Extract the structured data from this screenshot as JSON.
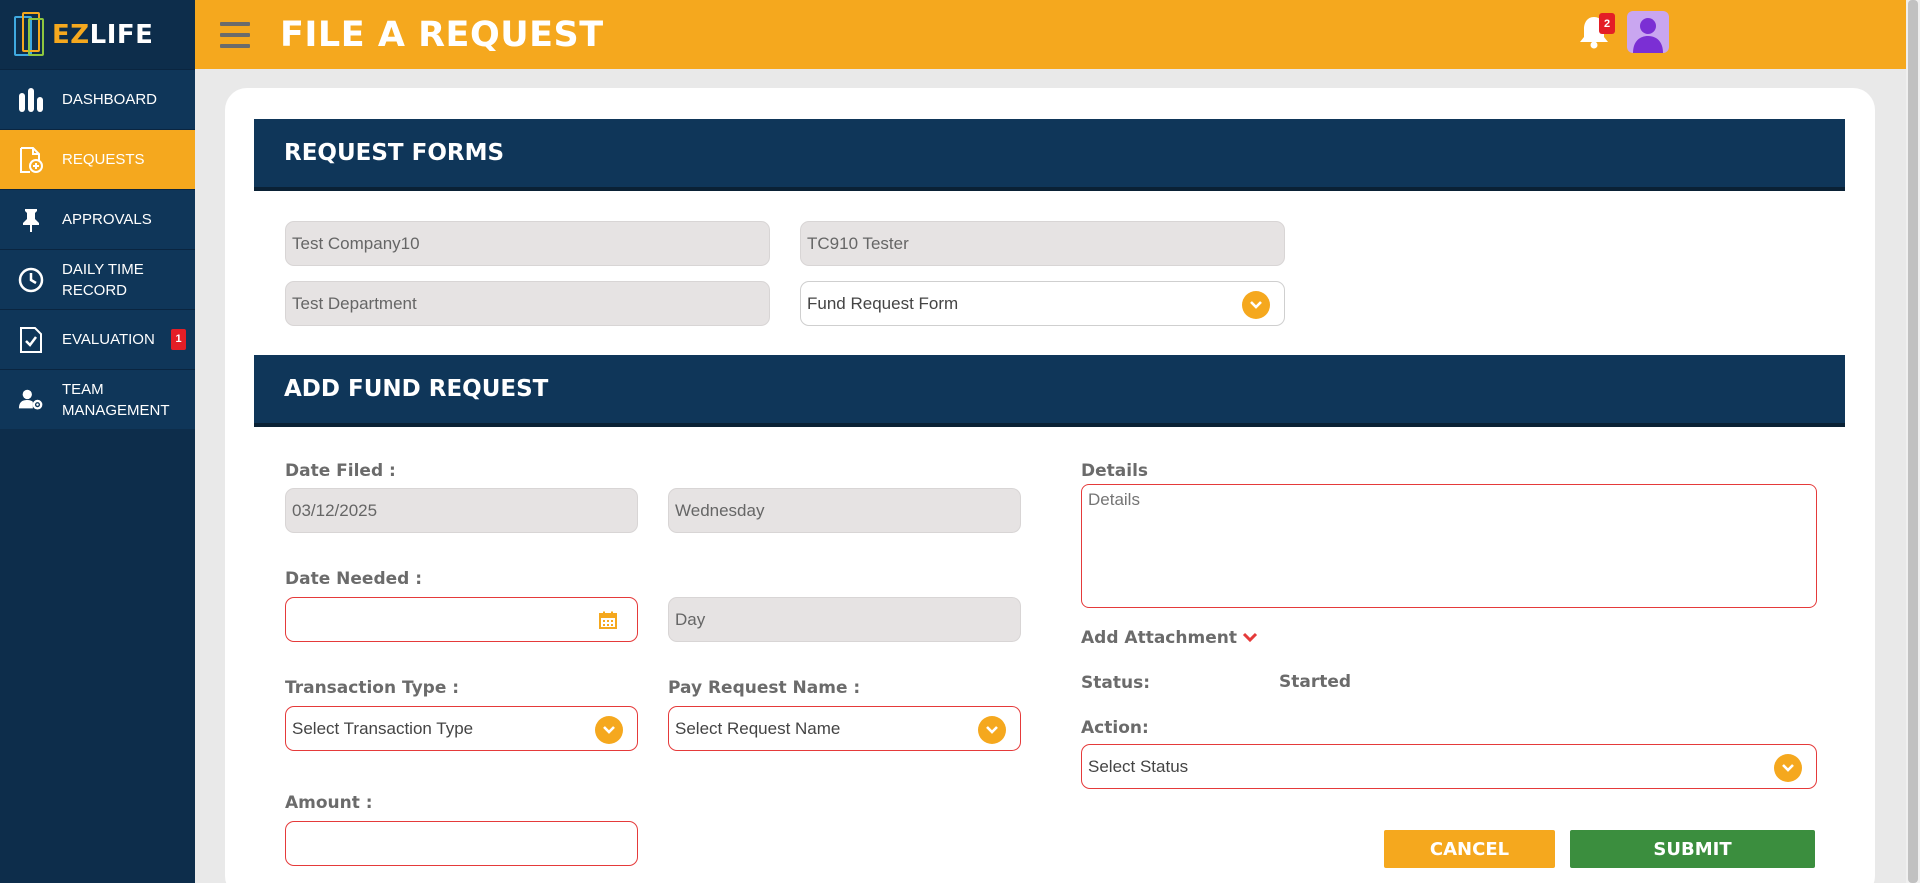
{
  "app": {
    "logo_ez": "EZ",
    "logo_life": "LIFE"
  },
  "colors": {
    "brand_orange": "#f5a81e",
    "navy": "#0f3659",
    "required_border": "#e53a3a",
    "submit_green": "#3b8e3e",
    "badge_red": "#e41e26"
  },
  "sidebar": {
    "items": [
      {
        "label": "Dashboard",
        "icon": "bar-chart-icon",
        "active": false
      },
      {
        "label": "Requests",
        "icon": "document-add-icon",
        "active": true
      },
      {
        "label": "Approvals",
        "icon": "pin-icon",
        "active": false
      },
      {
        "label": "Daily Time Record",
        "icon": "clock-icon",
        "active": false
      },
      {
        "label": "Evaluation",
        "icon": "checklist-icon",
        "active": false,
        "badge": "1"
      },
      {
        "label": "Team Management",
        "icon": "user-gear-icon",
        "active": false
      }
    ]
  },
  "header": {
    "title": "FILE A REQUEST",
    "notification_count": "2"
  },
  "request_forms": {
    "title": "REQUEST FORMS",
    "company": "Test Company10",
    "employee": "TC910 Tester",
    "department": "Test Department",
    "form_type": "Fund Request Form"
  },
  "fund_request": {
    "title": "ADD FUND REQUEST",
    "date_filed_label": "Date Filed :",
    "date_filed": "03/12/2025",
    "date_filed_day": "Wednesday",
    "date_needed_label": "Date Needed :",
    "date_needed": "",
    "date_needed_day_placeholder": "Day",
    "transaction_type_label": "Transaction Type :",
    "transaction_type_placeholder": "Select Transaction Type",
    "pay_request_name_label": "Pay Request Name :",
    "pay_request_name_placeholder": "Select Request Name",
    "amount_label": "Amount :",
    "amount": "",
    "details_label": "Details",
    "details_placeholder": "Details",
    "add_attachment_label": "Add Attachment",
    "status_label": "Status:",
    "status_value": "Started",
    "action_label": "Action:",
    "action_placeholder": "Select Status",
    "cancel_label": "CANCEL",
    "submit_label": "SUBMIT"
  }
}
